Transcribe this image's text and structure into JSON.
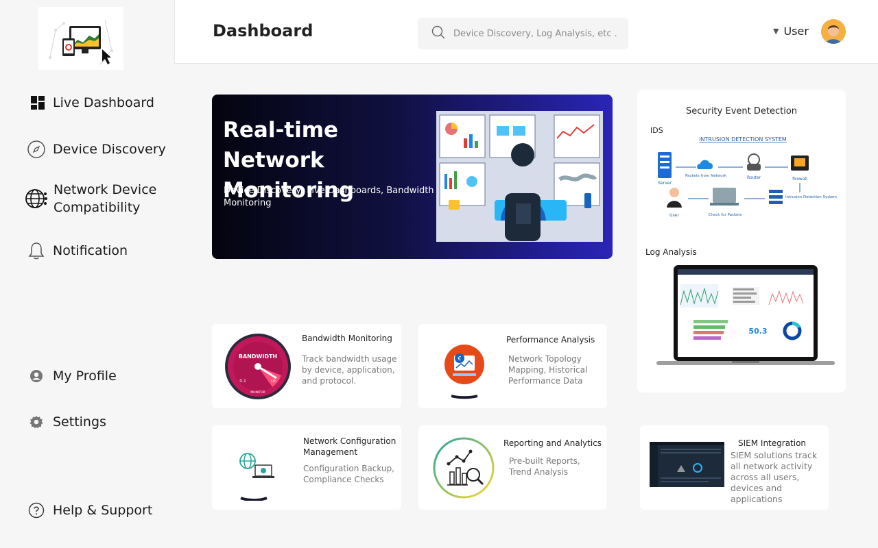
{
  "header": {
    "title": "Dashboard",
    "search_placeholder": "Device Discovery, Log Analysis, etc ...",
    "user_label": "User"
  },
  "sidebar": {
    "items": [
      {
        "label": "Live Dashboard",
        "icon": "dashboard-icon"
      },
      {
        "label": "Device Discovery",
        "icon": "compass-icon"
      },
      {
        "label": "Network Device Compatibility",
        "icon": "globe-network-icon"
      },
      {
        "label": "Notification",
        "icon": "bell-icon"
      },
      {
        "label": "My Profile",
        "icon": "user-circle-icon"
      },
      {
        "label": "Settings",
        "icon": "gear-icon"
      },
      {
        "label": "Help & Support",
        "icon": "help-icon"
      }
    ]
  },
  "hero": {
    "title": "Real-time Network Monitoring",
    "subtitle": "Device Discovery, Live Dashboards, Bandwidth Monitoring"
  },
  "side_card": {
    "title": "Security Event Detection",
    "ids_label": "IDS",
    "ids_diagram_title": "INTRUSION DETECTION SYSTEM",
    "ids_nodes": [
      "Server",
      "Packets from Network",
      "Router",
      "firewall",
      "User",
      "Check for Packets",
      "Intrusion Detection System"
    ],
    "log_label": "Log Analysis",
    "log_metric": "50.3"
  },
  "cards": [
    {
      "title": "Bandwidth Monitoring",
      "desc": "Track bandwidth usage by device, application, and protocol.",
      "gauge_label": "BANDWIDTH",
      "gauge_min": "0.1",
      "gauge_max": "10",
      "gauge_unit": "MONITOR"
    },
    {
      "title": "Performance Analysis",
      "desc": "Network Topology Mapping, Historical Performance Data"
    },
    {
      "title": "Network Configuration Management",
      "desc": "Configuration Backup, Compliance Checks"
    },
    {
      "title": "Reporting and Analytics",
      "desc": "Pre-built Reports, Trend Analysis"
    },
    {
      "title": "SIEM Integration",
      "desc": "SIEM solutions track all network activity across all users, devices and applications"
    }
  ],
  "colors": {
    "hero_start": "#04040f",
    "hero_end": "#2a24b8",
    "accent_pink": "#c2185b",
    "avatar": "#f5b041"
  }
}
